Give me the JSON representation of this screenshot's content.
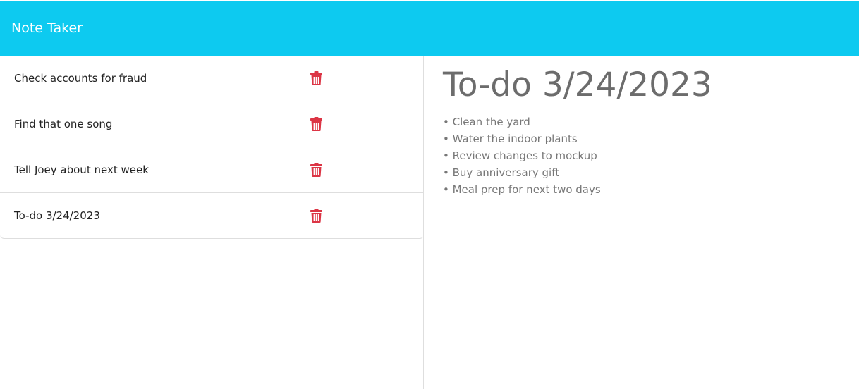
{
  "app": {
    "title": "Note Taker"
  },
  "notes": [
    {
      "title": "Check accounts for fraud"
    },
    {
      "title": "Find that one song"
    },
    {
      "title": "Tell Joey about next week"
    },
    {
      "title": "To-do 3/24/2023"
    }
  ],
  "icons": {
    "delete": "trash-icon"
  },
  "colors": {
    "navbar": "#0dcaf0",
    "delete_icon": "#dc3545"
  },
  "active_note": {
    "title": "To-do 3/24/2023",
    "lines": [
      "• Clean the yard",
      "• Water the indoor plants",
      "• Review changes to mockup",
      "• Buy anniversary gift",
      "• Meal prep for next two days"
    ]
  }
}
